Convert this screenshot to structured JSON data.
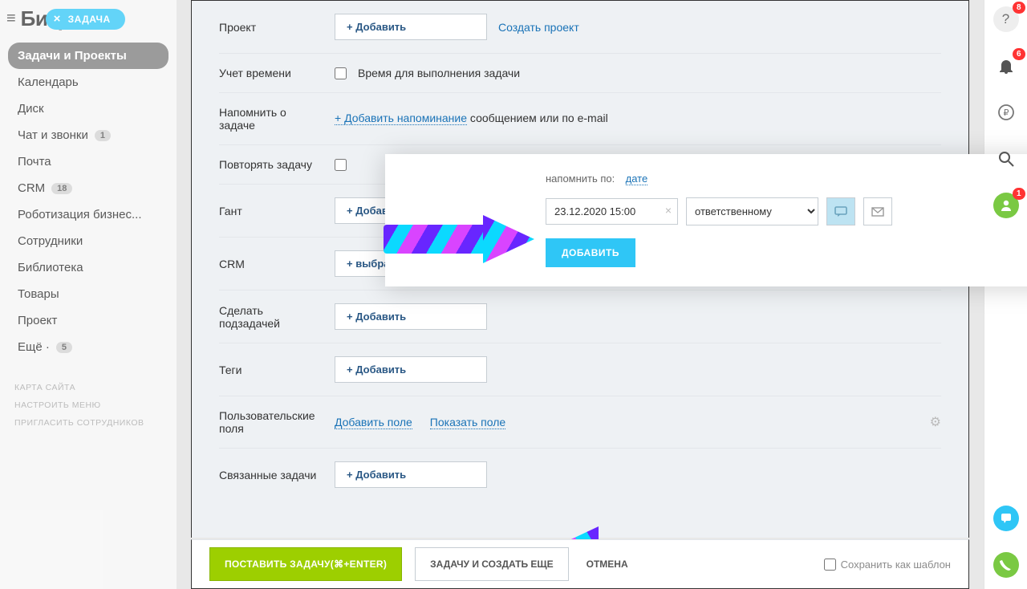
{
  "brand": "Битрикс",
  "task_pill": "ЗАДАЧА",
  "nav": {
    "items": [
      {
        "label": "Задачи и Проекты",
        "active": true
      },
      {
        "label": "Календарь"
      },
      {
        "label": "Диск"
      },
      {
        "label": "Чат и звонки",
        "badge": "1"
      },
      {
        "label": "Почта"
      },
      {
        "label": "CRM",
        "badge": "18"
      },
      {
        "label": "Роботизация бизнес..."
      },
      {
        "label": "Сотрудники"
      },
      {
        "label": "Библиотека"
      },
      {
        "label": "Товары"
      },
      {
        "label": "Проект"
      },
      {
        "label": "Ещё ·",
        "badge": "5"
      }
    ],
    "footer": [
      "КАРТА САЙТА",
      "НАСТРОИТЬ МЕНЮ",
      "ПРИГЛАСИТЬ СОТРУДНИКОВ"
    ]
  },
  "form": {
    "project_label": "Проект",
    "add_btn": "+ Добавить",
    "create_project": "Создать проект",
    "time_label": "Учет времени",
    "time_checkbox": "Время для выполнения задачи",
    "remind_label": "Напомнить о задаче",
    "add_reminder_link": "+ Добавить напоминание",
    "add_reminder_tail": " сообщением или по e-mail",
    "repeat_label": "Повторять задачу",
    "gantt_label": "Гант",
    "crm_label": "CRM",
    "select_btn": "+  выбрать",
    "subtask_label": "Сделать подзадачей",
    "tags_label": "Теги",
    "custom_label": "Пользовательские поля",
    "add_field_link": "Добавить поле",
    "show_field_link": "Показать поле",
    "related_label": "Связанные задачи"
  },
  "reminder": {
    "prefix": "напомнить по:",
    "mode": "дате",
    "datetime": "23.12.2020 15:00",
    "recipient": "ответственному",
    "add": "ДОБАВИТЬ"
  },
  "footer": {
    "submit": "ПОСТАВИТЬ ЗАДАЧУ(⌘+ENTER)",
    "submit_more": "ЗАДАЧУ И СОЗДАТЬ ЕЩЕ",
    "cancel": "ОТМЕНА",
    "save_tpl": "Сохранить как шаблон"
  },
  "rail": {
    "help_badge": "8",
    "bell_badge": "6",
    "user_badge": "1"
  }
}
